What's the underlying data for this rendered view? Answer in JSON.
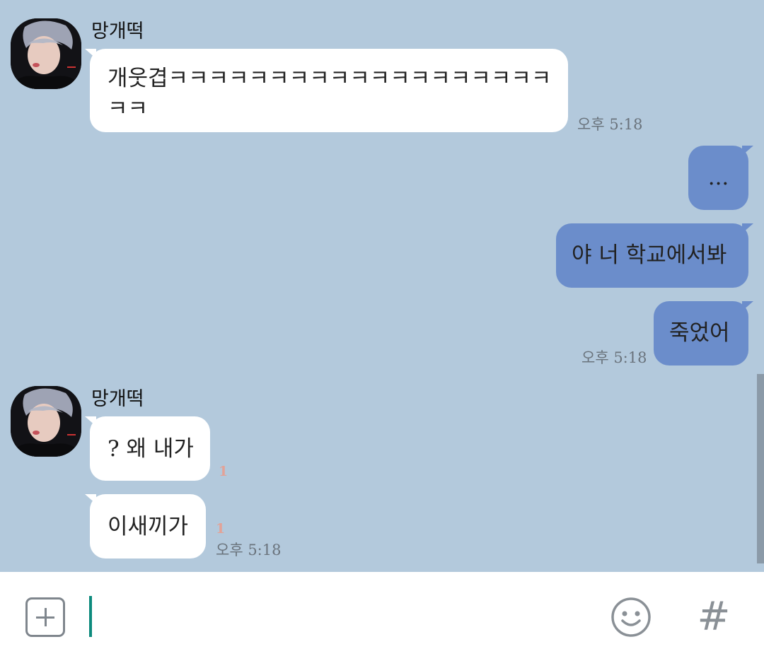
{
  "conversation": {
    "messages": [
      {
        "direction": "in",
        "sender": "망개떡",
        "avatar_icon": "profile-photo",
        "lines": [
          "개웃겹ㅋㅋㅋㅋㅋㅋㅋㅋㅋㅋㅋㅋㅋㅋㅋㅋㅋㅋㅋ",
          "ㅋㅋ"
        ],
        "time": "오후 5:18"
      },
      {
        "direction": "out",
        "text": "..."
      },
      {
        "direction": "out",
        "text": "야 너 학교에서봐"
      },
      {
        "direction": "out",
        "text": "죽었어",
        "time": "오후 5:18"
      },
      {
        "direction": "in",
        "sender": "망개떡",
        "avatar_icon": "profile-photo",
        "text": "? 왜 내가",
        "unread": "1"
      },
      {
        "direction": "in",
        "text": "이새끼가",
        "unread": "1",
        "time": "오후 5:18"
      }
    ]
  },
  "input_bar": {
    "plus_icon": "plus-square-icon",
    "emoji_icon": "smiley-icon",
    "hash_label": "#"
  },
  "colors": {
    "chat_background": "#b3c9dc",
    "incoming_bubble": "#ffffff",
    "outgoing_bubble": "#6b8dcb",
    "unread_count": "#e3a297",
    "cursor": "#0d8a7d"
  }
}
